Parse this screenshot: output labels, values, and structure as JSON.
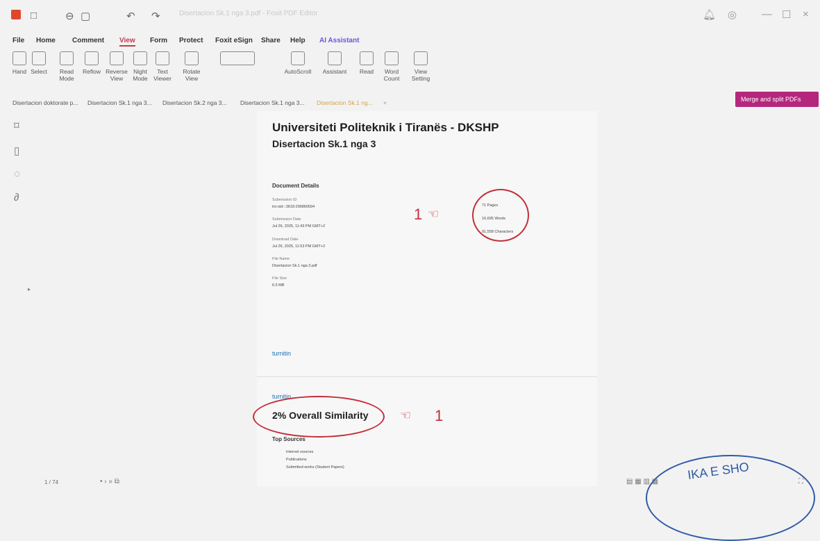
{
  "titlebar": {
    "doc_title": "Disertacion Sk.1 nga 3.pdf - Foxit PDF Editor"
  },
  "menu": {
    "items": [
      "File",
      "Home",
      "Comment",
      "View",
      "Form",
      "Protect",
      "Foxit eSign",
      "Share",
      "Help",
      "AI Assistant"
    ],
    "active": "View"
  },
  "ribbon": {
    "buttons": [
      {
        "label": "Hand",
        "icon": "hand-icon"
      },
      {
        "label": "Select",
        "icon": "select-icon"
      },
      {
        "label": "Read\nMode",
        "icon": "read-mode-icon"
      },
      {
        "label": "Reflow",
        "icon": "reflow-icon"
      },
      {
        "label": "Reverse\nView",
        "icon": "reverse-view-icon"
      },
      {
        "label": "Night\nMode",
        "icon": "night-mode-icon"
      },
      {
        "label": "Text\nViewer",
        "icon": "text-viewer-icon"
      },
      {
        "label": "Rotate\nView",
        "icon": "rotate-view-icon"
      },
      {
        "label": "AutoScroll",
        "icon": "autoscroll-icon"
      },
      {
        "label": "Assistant",
        "icon": "assistant-icon"
      },
      {
        "label": "Read",
        "icon": "read-aloud-icon"
      },
      {
        "label": "Word\nCount",
        "icon": "word-count-icon"
      },
      {
        "label": "View\nSetting",
        "icon": "view-setting-icon"
      }
    ]
  },
  "tabs": [
    "Disertacion doktorate p...",
    "Disertacion Sk.1 nga 3...",
    "Disertacion Sk.2 nga 3...",
    "Disertacion Sk.1 nga 3...",
    "Disertacion Sk.1 ng..."
  ],
  "merge_button": "Merge and split PDFs",
  "document": {
    "title": "Universiteti Politeknik i Tiranës - DKSHP",
    "subtitle": "Disertacion Sk.1 nga 3",
    "details_heading": "Document Details",
    "detail_labels": [
      "Submission ID",
      "Submission Date",
      "Download Date",
      "File Name",
      "File Size"
    ],
    "detail_values": [
      "trn:oid:::3618:296860594",
      "Jul 26, 2025, 11:43 PM GMT+2",
      "Jul 26, 2025, 11:53 PM GMT+2",
      "Disertacion Sk.1 nga 3.pdf",
      "6.5 MB"
    ],
    "stats": [
      "71 Pages",
      "16,695 Words",
      "91,558 Characters"
    ],
    "brand": "turnitin",
    "similarity": "2%  Overall Similarity",
    "top_sources": "Top Sources",
    "sources": [
      "Internet sources",
      "Publications",
      "Submitted works (Student Papers)"
    ],
    "annotation_mark": "1"
  },
  "status": {
    "page_indicator": "1 / 74"
  },
  "stamp_text": "IKA E SHO",
  "colors": {
    "accent_red": "#c12f3a",
    "merge_purple": "#b4277d",
    "turnitin_blue": "#1b6eb4"
  }
}
